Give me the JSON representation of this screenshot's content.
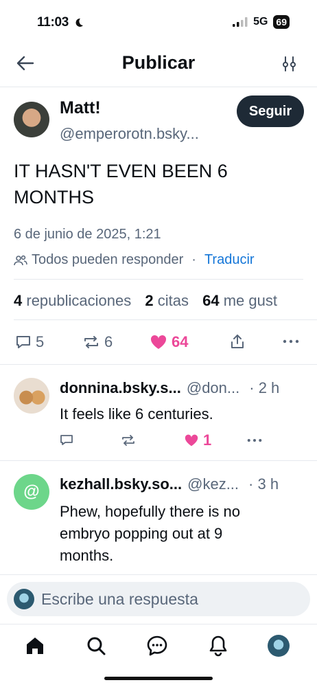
{
  "status": {
    "time": "11:03",
    "network": "5G",
    "battery": "69"
  },
  "header": {
    "title": "Publicar"
  },
  "post": {
    "author_name": "Matt!",
    "author_handle": "@emperorotn.bsky...",
    "follow_label": "Seguir",
    "text_line1": "IT HASN'T EVEN BEEN 6",
    "text_line2": "MONTHS",
    "timestamp": "6 de junio de 2025, 1:21",
    "reply_setting": "Todos pueden responder",
    "separator": "·",
    "translate_label": "Traducir",
    "stats": {
      "reposts_count": "4",
      "reposts_label": "republicaciones",
      "quotes_count": "2",
      "quotes_label": "citas",
      "likes_count": "64",
      "likes_label": "me gust"
    },
    "actions": {
      "replies": "5",
      "reposts": "6",
      "likes": "64"
    }
  },
  "replies": [
    {
      "name": "donnina.bsky.s...",
      "handle": "@don...",
      "time": "· 2 h",
      "text": "It feels like 6 centuries.",
      "likes": "1"
    },
    {
      "name": "kezhall.bsky.so...",
      "handle": "@kez...",
      "time": "· 3 h",
      "text_line1": "Phew, hopefully there is no",
      "text_line2": "embryo popping out at 9",
      "text_line3": "months.",
      "avatar_letter": "@"
    }
  ],
  "composer": {
    "placeholder": "Escribe una respuesta"
  },
  "colors": {
    "like": "#ec4899",
    "link": "#1476d8",
    "muted": "#59677a",
    "follow_bg": "#1e2a36",
    "avatar_green": "#6dd68a"
  },
  "icons": [
    "back-arrow-icon",
    "filter-settings-icon",
    "people-icon",
    "reply-icon",
    "repost-icon",
    "heart-icon",
    "share-icon",
    "more-icon",
    "home-icon",
    "search-icon",
    "chat-icon",
    "bell-icon"
  ]
}
